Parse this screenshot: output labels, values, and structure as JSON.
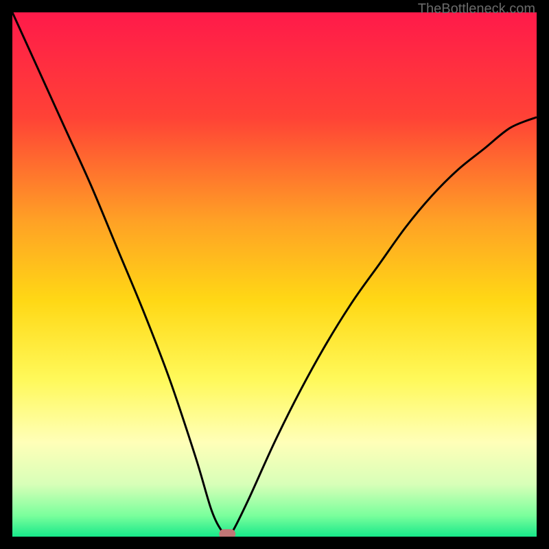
{
  "watermark": "TheBottleneck.com",
  "chart_data": {
    "type": "line",
    "title": "",
    "xlabel": "",
    "ylabel": "",
    "xlim": [
      0,
      100
    ],
    "ylim": [
      0,
      100
    ],
    "series": [
      {
        "name": "bottleneck-curve",
        "x": [
          0,
          5,
          10,
          15,
          20,
          25,
          30,
          35,
          38,
          40,
          41,
          42,
          45,
          50,
          55,
          60,
          65,
          70,
          75,
          80,
          85,
          90,
          95,
          100
        ],
        "values": [
          100,
          89,
          78,
          67,
          55,
          43,
          30,
          15,
          5,
          1,
          0.5,
          1,
          7,
          18,
          28,
          37,
          45,
          52,
          59,
          65,
          70,
          74,
          78,
          80
        ]
      }
    ],
    "minimum_point": {
      "x": 41,
      "y": 0.5
    },
    "marker": {
      "x": 41,
      "y": 0.5,
      "color": "#c17676"
    },
    "gradient_stops": [
      {
        "pos": 0.0,
        "color": "#ff1a4a"
      },
      {
        "pos": 0.2,
        "color": "#ff4236"
      },
      {
        "pos": 0.4,
        "color": "#ffa225"
      },
      {
        "pos": 0.55,
        "color": "#ffd815"
      },
      {
        "pos": 0.7,
        "color": "#fff95a"
      },
      {
        "pos": 0.82,
        "color": "#ffffb8"
      },
      {
        "pos": 0.9,
        "color": "#d8ffb8"
      },
      {
        "pos": 0.96,
        "color": "#7aff9c"
      },
      {
        "pos": 1.0,
        "color": "#17e88a"
      }
    ]
  }
}
